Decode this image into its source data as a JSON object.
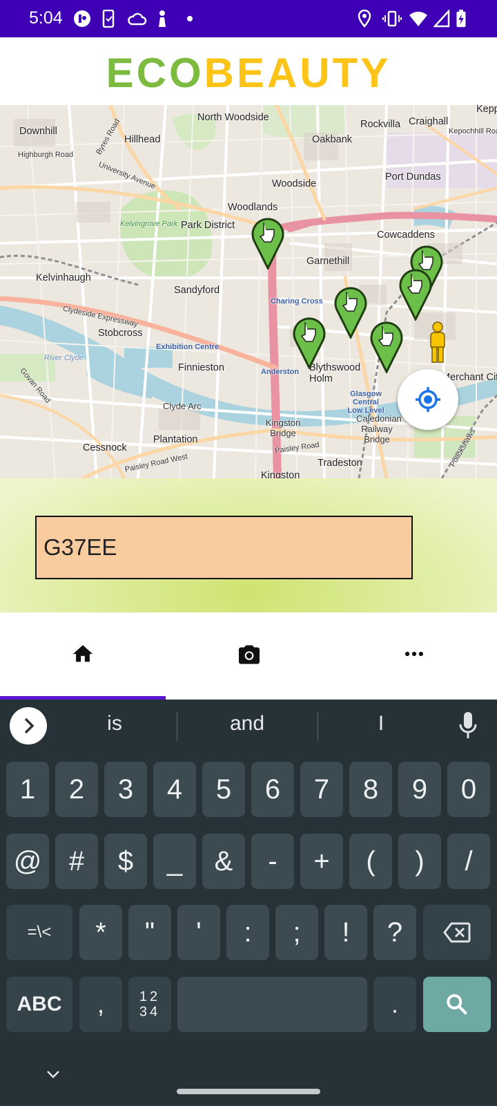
{
  "status_bar": {
    "time": "5:04"
  },
  "app": {
    "logo_part1": "ECO",
    "logo_part2": "BEAUTY",
    "colors": {
      "eco": "#7cbb3f",
      "beauty": "#fcc417",
      "status_bar": "#3f00b5",
      "input_bg": "#f8cc9e"
    }
  },
  "map": {
    "labels": [
      "North Woodside",
      "Kepp",
      "Downhill",
      "Rockvilla",
      "Craighall",
      "Kepochhill Road",
      "Hillhead",
      "Oakbank",
      "Highburgh Road",
      "Byres Road",
      "University Avenue",
      "Woodside",
      "Port Dundas",
      "Park District",
      "Woodlands",
      "Kelvingrove Park",
      "Cowcaddens",
      "Kelvinhaugh",
      "Sandyford",
      "Garnethill",
      "Charing Cross",
      "Stobcross",
      "Exhibition Centre",
      "Finnieston",
      "Blythswood Holm",
      "Anderston",
      "Merchant City",
      "Govan Road",
      "Clyde Arc",
      "Kingston Bridge",
      "Glasgow Central Low Level",
      "Caledonian Railway Bridge",
      "Cessnock",
      "Plantation",
      "Paisley Road",
      "Tradeston",
      "Kingston",
      "River Clyde",
      "Clydeside Expressway",
      "Paisley Road West",
      "Pollokshaws"
    ]
  },
  "search": {
    "value": "G37EE",
    "placeholder": ""
  },
  "bottom_nav": {
    "items": [
      {
        "icon": "home-icon",
        "active": true
      },
      {
        "icon": "camera-icon",
        "active": false
      },
      {
        "icon": "more-icon",
        "active": false
      }
    ]
  },
  "keyboard": {
    "suggestions": [
      "is",
      "and",
      "I"
    ],
    "row1": [
      "1",
      "2",
      "3",
      "4",
      "5",
      "6",
      "7",
      "8",
      "9",
      "0"
    ],
    "row2": [
      "@",
      "#",
      "$",
      "_",
      "&",
      "-",
      "+",
      "(",
      ")",
      "/"
    ],
    "row3": [
      "=\\<",
      "*",
      "\"",
      "'",
      ":",
      ";",
      "!",
      "?"
    ],
    "row4": {
      "abc": "ABC",
      "comma": ",",
      "numpad_top": "12",
      "numpad_bottom": "34",
      "period": "."
    }
  }
}
